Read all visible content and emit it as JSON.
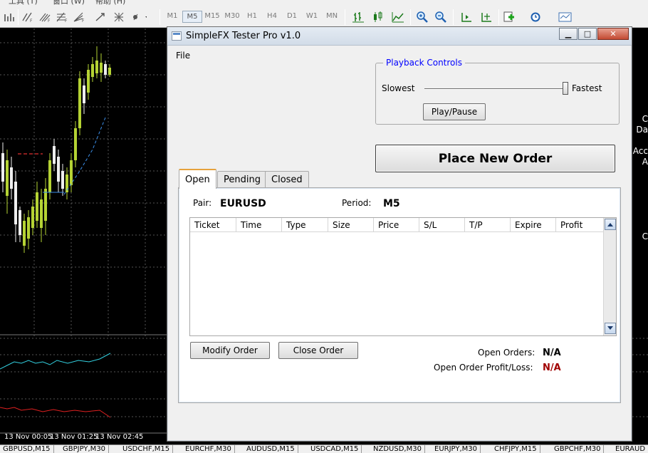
{
  "menubar": {
    "items": [
      "工具 (T)",
      "窗口 (W)",
      "帮助 (H)"
    ]
  },
  "toolbar": {
    "timeframes": [
      "M1",
      "M5",
      "M15",
      "M30",
      "H1",
      "H4",
      "D1",
      "W1",
      "MN"
    ],
    "active_timeframe": "M5"
  },
  "chart": {
    "time_labels": [
      "13 Nov 00:05",
      "13 Nov 01:25",
      "13 Nov 02:45"
    ],
    "right_labels": [
      "C",
      "Da",
      "Acc",
      "A",
      "C"
    ],
    "bottom_tabs": [
      "GBPUSD,M15",
      "GBPJPY,M30",
      "USDCHF,M15",
      "EURCHF,M30",
      "AUDUSD,M15",
      "USDCAD,M15",
      "NZDUSD,M30",
      "EURJPY,M30",
      "CHFJPY,M15",
      "GBPCHF,M30",
      "EURAUD"
    ]
  },
  "window": {
    "title": "SimpleFX Tester Pro v1.0",
    "menu_file": "File",
    "buttons": {
      "minimize": "▁",
      "maximize": "□",
      "close": "✕"
    }
  },
  "playback": {
    "legend": "Playback Controls",
    "slowest": "Slowest",
    "fastest": "Fastest",
    "play_pause": "Play/Pause"
  },
  "place_order_label": "Place New Order",
  "tabs": [
    "Open",
    "Pending",
    "Closed"
  ],
  "active_tab": "Open",
  "open_tab": {
    "pair_label": "Pair:",
    "pair_value": "EURUSD",
    "period_label": "Period:",
    "period_value": "M5",
    "columns": [
      "Ticket",
      "Time",
      "Type",
      "Size",
      "Price",
      "S/L",
      "T/P",
      "Expire",
      "Profit"
    ],
    "rows": [],
    "modify_label": "Modify Order",
    "close_label": "Close Order",
    "open_orders_label": "Open Orders:",
    "open_orders_value": "N/A",
    "pl_label": "Open Order Profit/Loss:",
    "pl_value": "N/A"
  },
  "colors": {
    "accent_blue": "#0000ff",
    "loss_red": "#a00000",
    "tab_highlight": "#e6a23c"
  }
}
